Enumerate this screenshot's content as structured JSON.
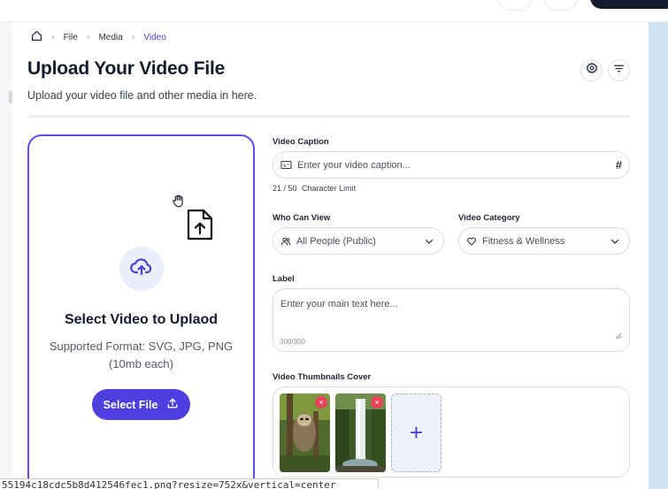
{
  "breadcrumb": {
    "items": [
      "File",
      "Media",
      "Video"
    ]
  },
  "header": {
    "title": "Upload Your Video File",
    "subtitle": "Upload your video file and other media in here."
  },
  "upload": {
    "title": "Select Video to Uplaod",
    "format_line1": "Supported Format: SVG, JPG, PNG",
    "format_line2": "(10mb each)",
    "button_label": "Select File"
  },
  "form": {
    "caption_label": "Video Caption",
    "caption_placeholder": "Enter your video caption...",
    "caption_counter": "21 / 50",
    "caption_counter_suffix": "Character Limit",
    "who_label": "Who Can View",
    "who_value": "All People (Public)",
    "category_label": "Video Category",
    "category_value": "Fitness & Wellness",
    "label_label": "Label",
    "label_placeholder": "Enter your main text here...",
    "label_counter": "300/300",
    "thumbs_label": "Video Thumbnails Cover",
    "add_symbol": "+",
    "remove_symbol": "×"
  },
  "colors": {
    "accent": "#4f3fe0",
    "danger": "#e5435a",
    "text_dark": "#161a2e"
  },
  "statusbar": {
    "text": "55194c18cdc5b8d412546fec1.png?resize=752x&vertical=center"
  }
}
